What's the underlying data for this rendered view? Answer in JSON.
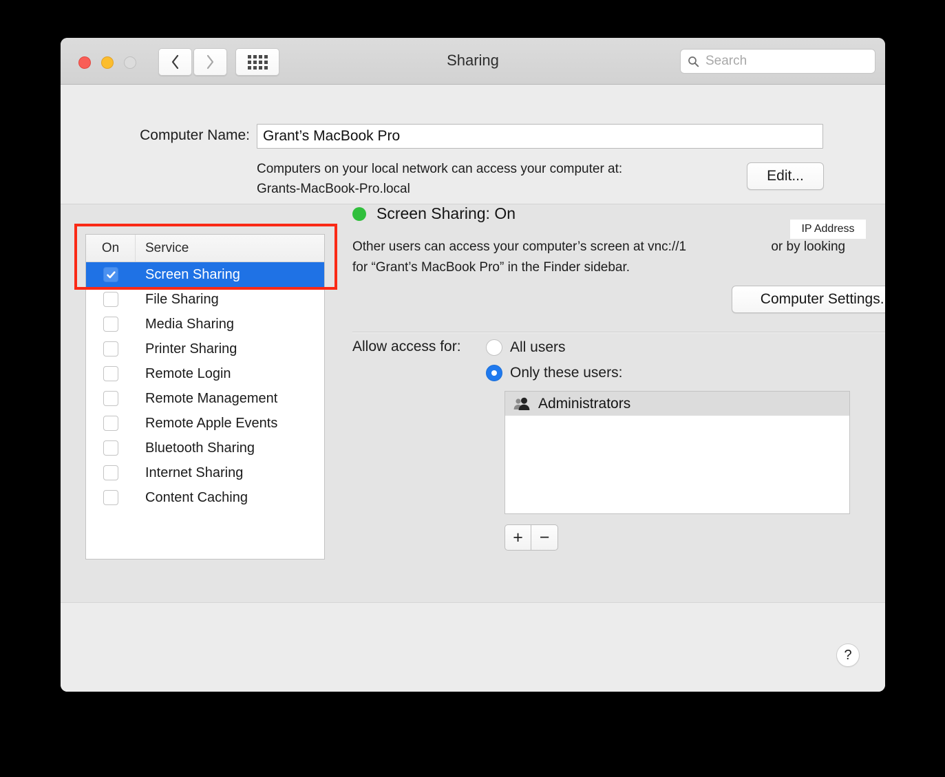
{
  "window": {
    "title": "Sharing",
    "traffic_lights": [
      "close",
      "minimize",
      "zoom"
    ],
    "search": {
      "placeholder": "Search",
      "value": ""
    }
  },
  "computer_name": {
    "label": "Computer Name:",
    "value": "Grant’s MacBook Pro",
    "help_line1": "Computers on your local network can access your computer at:",
    "help_line2": "Grants-MacBook-Pro.local",
    "edit_button": "Edit..."
  },
  "services": {
    "header": {
      "on": "On",
      "service": "Service"
    },
    "items": [
      {
        "name": "Screen Sharing",
        "checked": true,
        "selected": true
      },
      {
        "name": "File Sharing",
        "checked": false,
        "selected": false
      },
      {
        "name": "Media Sharing",
        "checked": false,
        "selected": false
      },
      {
        "name": "Printer Sharing",
        "checked": false,
        "selected": false
      },
      {
        "name": "Remote Login",
        "checked": false,
        "selected": false
      },
      {
        "name": "Remote Management",
        "checked": false,
        "selected": false
      },
      {
        "name": "Remote Apple Events",
        "checked": false,
        "selected": false
      },
      {
        "name": "Bluetooth Sharing",
        "checked": false,
        "selected": false
      },
      {
        "name": "Internet Sharing",
        "checked": false,
        "selected": false
      },
      {
        "name": "Content Caching",
        "checked": false,
        "selected": false
      }
    ]
  },
  "detail": {
    "status_text": "Screen Sharing: On",
    "status_color": "#30bf3c",
    "description_before": "Other users can access your computer’s screen at vnc://1",
    "description_after": "or by looking for “Grant’s MacBook Pro” in the Finder sidebar.",
    "ip_redaction_label": "IP Address",
    "computer_settings_button": "Computer Settings...",
    "allow_access_label": "Allow access for:",
    "options": [
      {
        "label": "All users",
        "selected": false
      },
      {
        "label": "Only these users:",
        "selected": true
      }
    ],
    "users": [
      {
        "name": "Administrators",
        "icon": "group-icon"
      }
    ],
    "add_button": "+",
    "remove_button": "−"
  },
  "annotation": {
    "color": "#fa2a16"
  },
  "footer": {
    "help_button": "?"
  }
}
